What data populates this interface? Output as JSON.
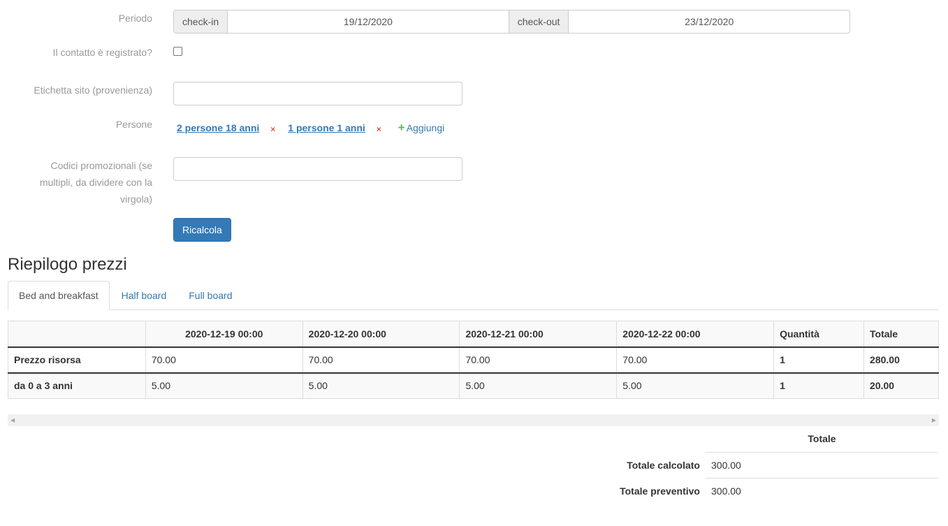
{
  "form": {
    "period_label": "Periodo",
    "checkin_label": "check-in",
    "checkin_value": "19/12/2020",
    "checkout_label": "check-out",
    "checkout_value": "23/12/2020",
    "registered_label": "Il contatto è registrato?",
    "site_label_label": "Etichetta sito (provenienza)",
    "persons_label": "Persone",
    "persons": [
      {
        "text": "2 persone 18 anni"
      },
      {
        "text": "1 persone 1 anni"
      }
    ],
    "remove_symbol": "×",
    "add_symbol": "+",
    "add_label": "Aggiungi",
    "promo_label_lines": [
      "Codici promozionali (se",
      "multipli, da dividere con la",
      "virgola)"
    ],
    "recalc_button": "Ricalcola"
  },
  "summary": {
    "title": "Riepilogo prezzi",
    "tabs": [
      {
        "label": "Bed and breakfast",
        "active": true
      },
      {
        "label": "Half board",
        "active": false
      },
      {
        "label": "Full board",
        "active": false
      }
    ],
    "table": {
      "headers": [
        "",
        "2020-12-19 00:00",
        "2020-12-20 00:00",
        "2020-12-21 00:00",
        "2020-12-22 00:00",
        "Quantità",
        "Totale"
      ],
      "rows": [
        [
          "Prezzo risorsa",
          "70.00",
          "70.00",
          "70.00",
          "70.00",
          "1",
          "280.00"
        ],
        [
          "da 0 a 3 anni",
          "5.00",
          "5.00",
          "5.00",
          "5.00",
          "1",
          "20.00"
        ]
      ]
    },
    "scroll_left": "◀",
    "scroll_right": "▶",
    "totals": {
      "header": "Totale",
      "calculated_label": "Totale calcolato",
      "calculated_value": "300.00",
      "quote_label": "Totale preventivo",
      "quote_value": "300.00"
    }
  }
}
